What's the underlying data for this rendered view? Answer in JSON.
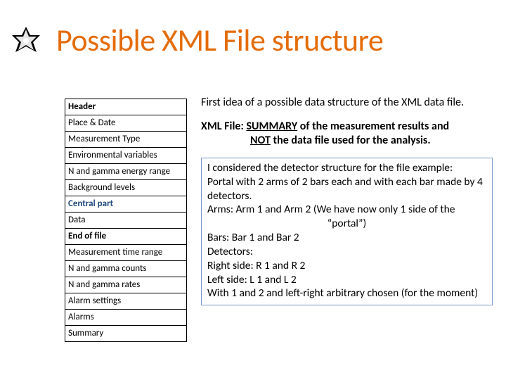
{
  "title": "Possible XML File structure",
  "table": {
    "rows": [
      {
        "text": "Header",
        "style": "bold"
      },
      {
        "text": "Place & Date",
        "style": ""
      },
      {
        "text": "Measurement Type",
        "style": ""
      },
      {
        "text": "Environmental variables",
        "style": ""
      },
      {
        "text": "N and gamma energy range",
        "style": ""
      },
      {
        "text": "Background levels",
        "style": ""
      },
      {
        "text": "Central part",
        "style": "blue"
      },
      {
        "text": "Data",
        "style": ""
      },
      {
        "text": "End of file",
        "style": "bold"
      },
      {
        "text": "Measurement time range",
        "style": ""
      },
      {
        "text": "N and gamma counts",
        "style": ""
      },
      {
        "text": "N and gamma rates",
        "style": ""
      },
      {
        "text": "Alarm settings",
        "style": ""
      },
      {
        "text": "Alarms",
        "style": ""
      },
      {
        "text": "Summary",
        "style": ""
      }
    ]
  },
  "body": {
    "p1": "First idea of a possible data structure of the XML data file.",
    "xml_prefix": "XML File:  ",
    "xml_summary": "SUMMARY",
    "xml_after": " of the measurement results and",
    "xml_not": "NOT",
    "xml_not_after": " the data file used for the analysis.",
    "box_l1": "I considered the detector structure for the file example:",
    "box_l2": "Portal with 2 arms of 2 bars each and with each bar made by 4 detectors.",
    "box_l3a": "Arms: Arm 1 and Arm 2 (We have now only 1 side of the",
    "box_l3b": "“portal”)",
    "box_l4": "Bars: Bar 1 and Bar 2",
    "box_l5": "Detectors:",
    "box_l6": "Right side: R 1 and R 2",
    "box_l7": "Left side: L 1 and L 2",
    "box_l8": "With 1 and 2 and left-right arbitrary chosen (for the moment)"
  }
}
